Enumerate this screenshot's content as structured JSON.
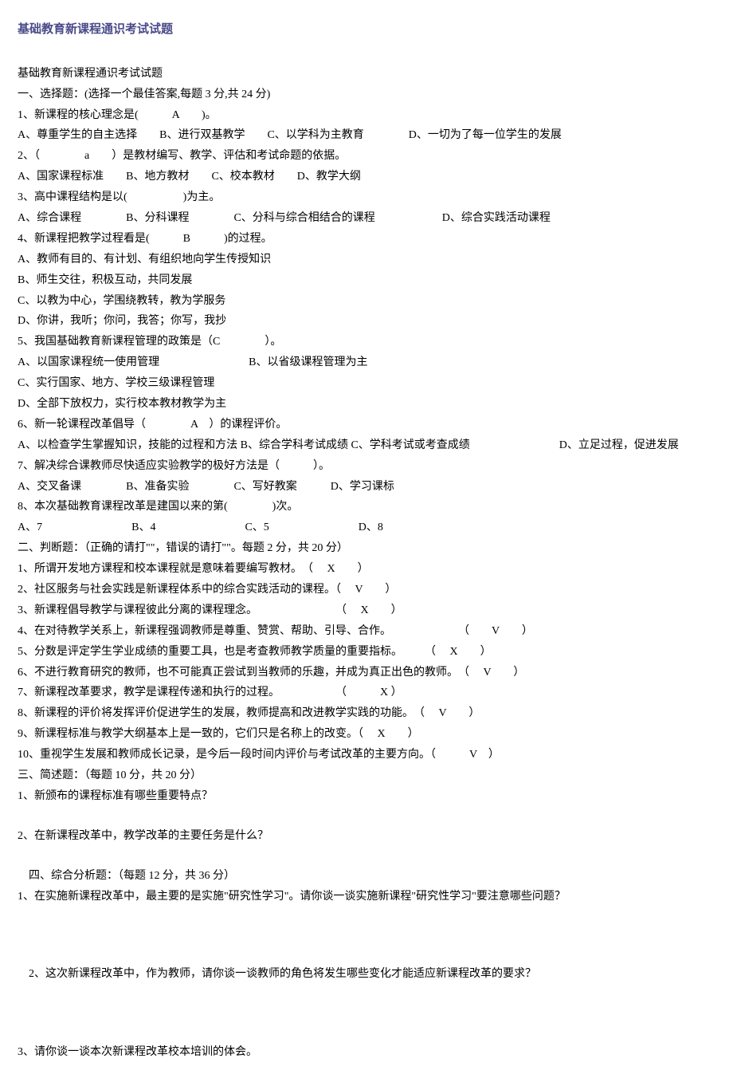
{
  "title": "基础教育新课程通识考试试题",
  "lines": [
    "基础教育新课程通识考试试题",
    "一、选择题：(选择一个最佳答案,每题 3 分,共 24 分)",
    "1、新课程的核心理念是(　　　A　　)。",
    "A、尊重学生的自主选择　　B、进行双基教学　　C、以学科为主教育　　　　D、一切为了每一位学生的发展",
    "2、（　　　　a　　）是教材编写、教学、评估和考试命题的依据。",
    "A、国家课程标准　　B、地方教材　　C、校本教材　　D、教学大纲",
    "3、高中课程结构是以(　　　　　)为主。",
    "A、综合课程　　　　B、分科课程　　　　C、分科与综合相结合的课程　　　　　　D、综合实践活动课程",
    "4、新课程把教学过程看是(　　　B　　　)的过程。",
    "A、教师有目的、有计划、有组织地向学生传授知识",
    "B、师生交往，积极互动，共同发展",
    "C、以教为中心，学围绕教转，教为学服务",
    "D、你讲，我听；你问，我答；你写，我抄",
    "5、我国基础教育新课程管理的政策是（C　　　　）。",
    "A、以国家课程统一使用管理　　　　　　　　B、以省级课程管理为主",
    "C、实行国家、地方、学校三级课程管理",
    "D、全部下放权力，实行校本教材教学为主",
    "6、新一轮课程改革倡导（　　　　A　）的课程评价。",
    "A、以检查学生掌握知识，技能的过程和方法 B、综合学科考试成绩 C、学科考试或考查成绩　　　　　　　　D、立足过程，促进发展",
    "7、解决综合课教师尽快适应实验教学的极好方法是（　　　）。",
    "A、交叉备课　　　　B、准备实验　　　　C、写好教案　　　D、学习课标",
    "8、本次基础教育课程改革是建国以来的第(　　　　)次。",
    "A、7　　　　　　　　B、4　　　　　　　　C、5　　　　　　　　D、8",
    "二、判断题：（正确的请打\"\"，错误的请打\"\"。每题 2 分，共 20 分）",
    "1、所谓开发地方课程和校本课程就是意味着要编写教材。　（　 X　　）",
    "2、社区服务与社会实践是新课程体系中的综合实践活动的课程。（　 V　　）",
    "3、新课程倡导教学与课程彼此分离的课程理念。　　　　　　　　（　 X　　）",
    "4、在对待教学关系上，新课程强调教师是尊重、赞赏、帮助、引导、合作。　　　　　　　（　　V　　）",
    "5、分数是评定学生学业成绩的重要工具，也是考查教师教学质量的重要指标。　　　（　 X　　）",
    "6、不进行教育研究的教师，也不可能真正尝试到当教师的乐趣，并成为真正出色的教师。　（　 V　　）",
    "7、新课程改革要求，教学是课程传递和执行的过程。　　　　　　（　　　X ）",
    "8、新课程的评价将发挥评价促进学生的发展，教师提高和改进教学实践的功能。　（　 V　　）",
    "9、新课程标准与教学大纲基本上是一致的，它们只是名称上的改变。（　 X　　）",
    "10、重视学生发展和教师成长记录，是今后一段时间内评价与考试改革的主要方向。（　　　V　）",
    "三、简述题：（每题 10 分，共 20 分）",
    "1、新颁布的课程标准有哪些重要特点？"
  ],
  "q2": "2、在新课程改革中，教学改革的主要任务是什么？",
  "section4": "　四、综合分析题：（每题 12 分，共 36 分）",
  "s4q1": "1、在实施新课程改革中，最主要的是实施\"研究性学习\"。请你谈一谈实施新课程\"研究性学习\"要注意哪些问题？",
  "s4q2": "　2、这次新课程改革中，作为教师，请你谈一谈教师的角色将发生哪些变化才能适应新课程改革的要求？",
  "s4q3": "3、请你谈一谈本次新课程改革校本培训的体会。"
}
